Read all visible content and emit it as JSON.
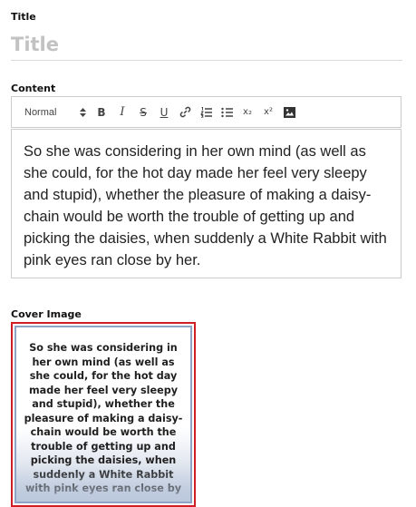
{
  "title_field": {
    "label": "Title",
    "placeholder": "Title",
    "value": ""
  },
  "content_field": {
    "label": "Content",
    "toolbar": {
      "heading_select": "Normal",
      "buttons": [
        {
          "name": "bold",
          "glyph": "B"
        },
        {
          "name": "italic",
          "glyph": "I"
        },
        {
          "name": "strike",
          "glyph": "S"
        },
        {
          "name": "underline",
          "glyph": "U"
        },
        {
          "name": "link",
          "icon": "link-icon"
        },
        {
          "name": "ordered-list",
          "icon": "ordered-list-icon"
        },
        {
          "name": "bullet-list",
          "icon": "bullet-list-icon"
        },
        {
          "name": "subscript",
          "glyph": "x₂"
        },
        {
          "name": "superscript",
          "glyph": "x²"
        },
        {
          "name": "image",
          "icon": "image-icon"
        }
      ]
    },
    "body_text": "So she was considering in her own mind (as well as she could, for the hot day made her feel very sleepy and stupid), whether the pleasure of making a daisy-chain would be worth the trouble of getting up and picking the daisies, when suddenly a White Rabbit with pink eyes ran close by her."
  },
  "cover_field": {
    "label": "Cover Image",
    "image_text": "So she was considering in her own mind (as well as she could, for the hot day made her feel very sleepy and stupid), whether the pleasure of making a daisy-chain would be worth the trouble of getting up and picking the daisies, when suddenly a White Rabbit with pink eyes ran close by"
  },
  "colors": {
    "cover_selected_border": "#d01e26",
    "editor_border": "#cccccc",
    "placeholder": "#c2c2c2"
  }
}
